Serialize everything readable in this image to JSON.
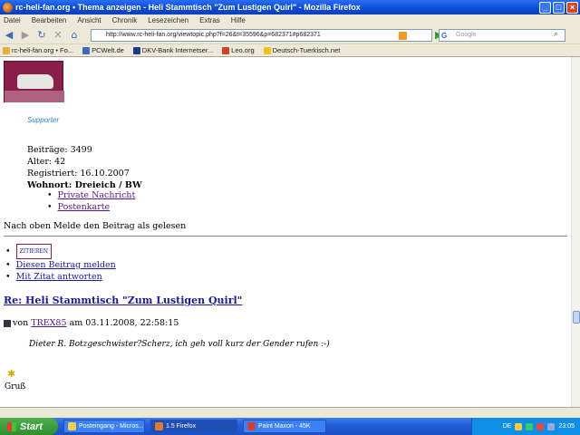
{
  "window": {
    "title": "rc-heli-fan.org • Thema anzeigen - Heli Stammtisch \"Zum Lustigen Quirl\" - Mozilla Firefox"
  },
  "menu": [
    "Datei",
    "Bearbeiten",
    "Ansicht",
    "Chronik",
    "Lesezeichen",
    "Extras",
    "Hilfe"
  ],
  "nav": {
    "url": "http://www.rc-heli-fan.org/viewtopic.php?f=26&t=35596&p=682371#p682371",
    "search_placeholder": "Google"
  },
  "bookmarks": [
    {
      "label": "rc-heli-fan.org • Fo..."
    },
    {
      "label": "PCWelt.de"
    },
    {
      "label": "DKV-Bank Internetser..."
    },
    {
      "label": "Leo.org"
    },
    {
      "label": "Deutsch-Tuerkisch.net"
    }
  ],
  "profile": {
    "supporter_label": "Supporter",
    "posts": "Beiträge: 3499",
    "age": "Alter: 42",
    "registered": "Registriert: 16.10.2007",
    "residence": "Wohnort: Dreieich / BW",
    "links": [
      "Private Nachricht",
      "Postenkarte"
    ]
  },
  "post_links": {
    "top_line": "Nach oben Melde den Beitrag als gelesen",
    "quote_button": "ZITIEREN",
    "report": "Diesen Beitrag melden",
    "reply_quote": "Mit Zitat antworten"
  },
  "post": {
    "title": "Re: Heli Stammtisch \"Zum Lustigen Quirl\"",
    "by_prefix": "von",
    "author": "TREX85",
    "date": "am 03.11.2008, 22:58:15",
    "body": "Dieter R. Botzgeschwister?Scherz, ich geh voll kurz der Gender rufen :-)",
    "greeting": "Gruß"
  },
  "taskbar": {
    "start": "Start",
    "tasks": [
      "Posteingang - Micros...",
      "1.5 Firefox",
      "Paint Maxon - 45K"
    ],
    "clock": "23:05",
    "lang": "DE"
  }
}
